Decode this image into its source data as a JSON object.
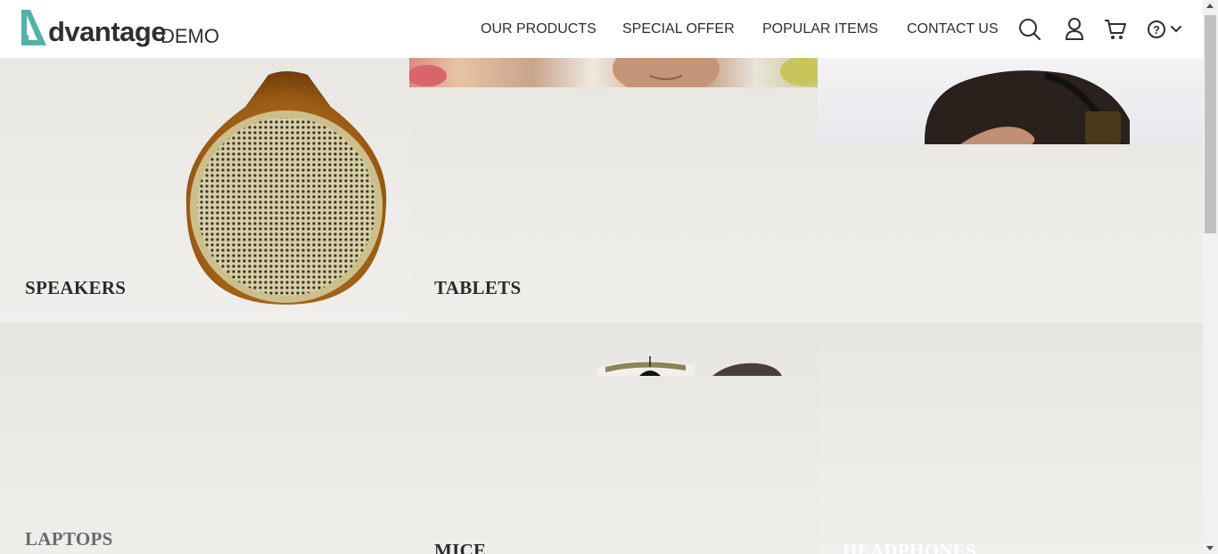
{
  "brand": {
    "word": "dvantage",
    "demo": "DEMO",
    "accent": "#53b2a8"
  },
  "nav": {
    "items": [
      {
        "label": "OUR PRODUCTS"
      },
      {
        "label": "SPECIAL OFFER"
      },
      {
        "label": "POPULAR ITEMS"
      },
      {
        "label": "CONTACT US"
      }
    ],
    "icons": [
      "search-icon",
      "user-icon",
      "cart-icon",
      "help-icon",
      "chevron-down-icon"
    ]
  },
  "categories": {
    "speakers": "SPEAKERS",
    "tablets": "TABLETS",
    "laptops": "LAPTOPS",
    "mice": "MICE",
    "headphones": "HEADPHONES"
  }
}
